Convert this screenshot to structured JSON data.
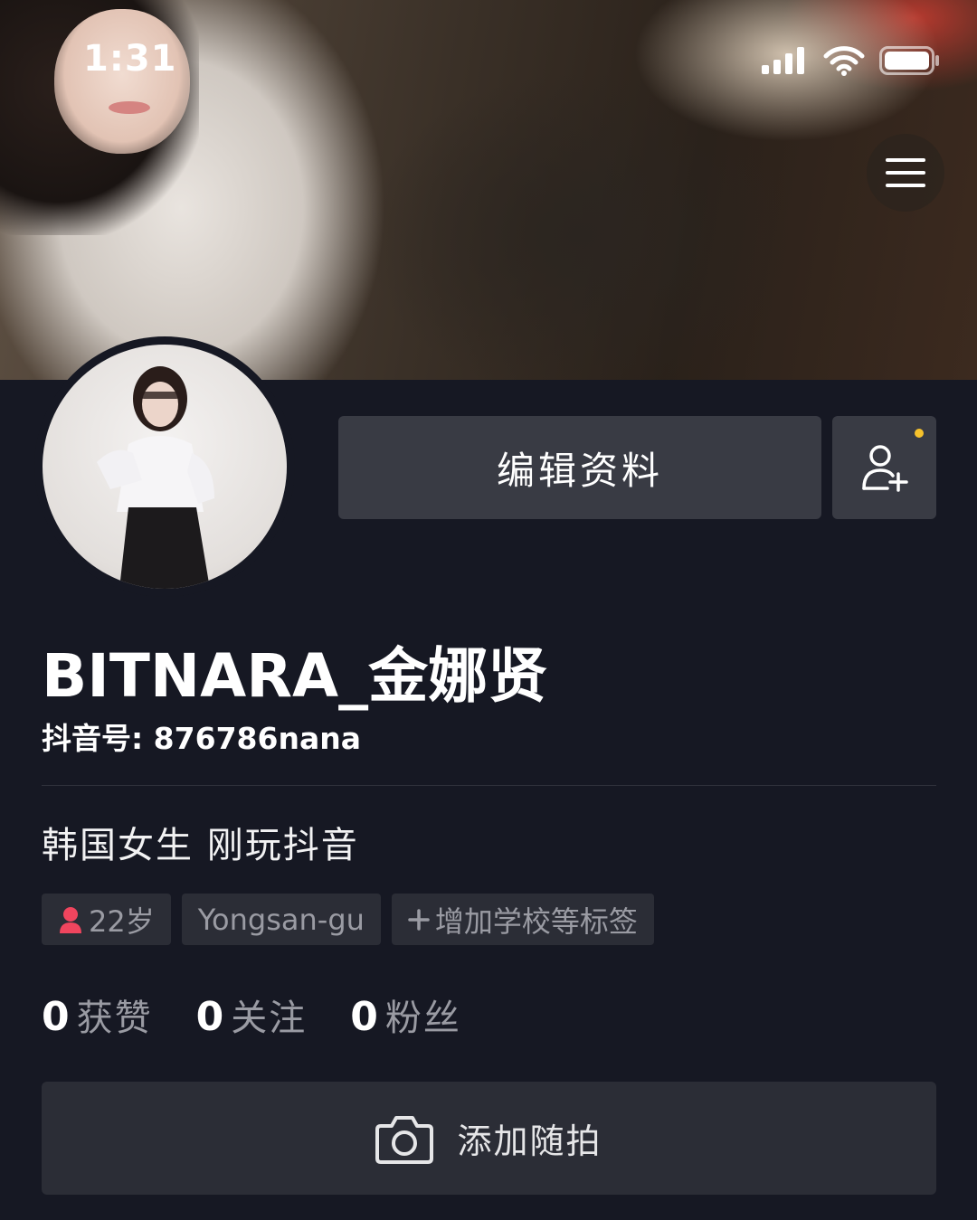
{
  "status_bar": {
    "time": "1:31"
  },
  "header": {
    "menu_icon": "hamburger-menu-icon"
  },
  "profile": {
    "nickname": "BITNARA_金娜贤",
    "douyin_id": "抖音号: 876786nana",
    "bio": "韩国女生 刚玩抖音",
    "edit_button_label": "编辑资料",
    "add_friend_icon": "add-friend-icon",
    "notification_dot_color": "#f6c22c",
    "tags": {
      "age": "22岁",
      "location": "Yongsan-gu",
      "add_tag": "增加学校等标签"
    },
    "stats": {
      "likes": {
        "count": "0",
        "label": "获赞"
      },
      "following": {
        "count": "0",
        "label": "关注"
      },
      "followers": {
        "count": "0",
        "label": "粉丝"
      }
    },
    "snap_button_label": "添加随拍"
  },
  "colors": {
    "background": "#161823",
    "button": "#393b44",
    "tag_background": "#2b2d36",
    "muted_text": "#9a9ba3",
    "female_icon": "#f0455e"
  }
}
